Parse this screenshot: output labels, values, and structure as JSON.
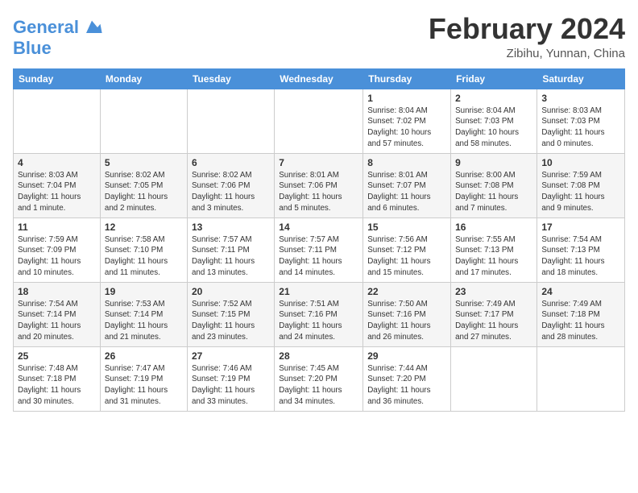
{
  "header": {
    "logo_line1": "General",
    "logo_line2": "Blue",
    "month": "February 2024",
    "location": "Zibihu, Yunnan, China"
  },
  "weekdays": [
    "Sunday",
    "Monday",
    "Tuesday",
    "Wednesday",
    "Thursday",
    "Friday",
    "Saturday"
  ],
  "weeks": [
    [
      {
        "day": "",
        "info": ""
      },
      {
        "day": "",
        "info": ""
      },
      {
        "day": "",
        "info": ""
      },
      {
        "day": "",
        "info": ""
      },
      {
        "day": "1",
        "info": "Sunrise: 8:04 AM\nSunset: 7:02 PM\nDaylight: 10 hours\nand 57 minutes."
      },
      {
        "day": "2",
        "info": "Sunrise: 8:04 AM\nSunset: 7:03 PM\nDaylight: 10 hours\nand 58 minutes."
      },
      {
        "day": "3",
        "info": "Sunrise: 8:03 AM\nSunset: 7:03 PM\nDaylight: 11 hours\nand 0 minutes."
      }
    ],
    [
      {
        "day": "4",
        "info": "Sunrise: 8:03 AM\nSunset: 7:04 PM\nDaylight: 11 hours\nand 1 minute."
      },
      {
        "day": "5",
        "info": "Sunrise: 8:02 AM\nSunset: 7:05 PM\nDaylight: 11 hours\nand 2 minutes."
      },
      {
        "day": "6",
        "info": "Sunrise: 8:02 AM\nSunset: 7:06 PM\nDaylight: 11 hours\nand 3 minutes."
      },
      {
        "day": "7",
        "info": "Sunrise: 8:01 AM\nSunset: 7:06 PM\nDaylight: 11 hours\nand 5 minutes."
      },
      {
        "day": "8",
        "info": "Sunrise: 8:01 AM\nSunset: 7:07 PM\nDaylight: 11 hours\nand 6 minutes."
      },
      {
        "day": "9",
        "info": "Sunrise: 8:00 AM\nSunset: 7:08 PM\nDaylight: 11 hours\nand 7 minutes."
      },
      {
        "day": "10",
        "info": "Sunrise: 7:59 AM\nSunset: 7:08 PM\nDaylight: 11 hours\nand 9 minutes."
      }
    ],
    [
      {
        "day": "11",
        "info": "Sunrise: 7:59 AM\nSunset: 7:09 PM\nDaylight: 11 hours\nand 10 minutes."
      },
      {
        "day": "12",
        "info": "Sunrise: 7:58 AM\nSunset: 7:10 PM\nDaylight: 11 hours\nand 11 minutes."
      },
      {
        "day": "13",
        "info": "Sunrise: 7:57 AM\nSunset: 7:11 PM\nDaylight: 11 hours\nand 13 minutes."
      },
      {
        "day": "14",
        "info": "Sunrise: 7:57 AM\nSunset: 7:11 PM\nDaylight: 11 hours\nand 14 minutes."
      },
      {
        "day": "15",
        "info": "Sunrise: 7:56 AM\nSunset: 7:12 PM\nDaylight: 11 hours\nand 15 minutes."
      },
      {
        "day": "16",
        "info": "Sunrise: 7:55 AM\nSunset: 7:13 PM\nDaylight: 11 hours\nand 17 minutes."
      },
      {
        "day": "17",
        "info": "Sunrise: 7:54 AM\nSunset: 7:13 PM\nDaylight: 11 hours\nand 18 minutes."
      }
    ],
    [
      {
        "day": "18",
        "info": "Sunrise: 7:54 AM\nSunset: 7:14 PM\nDaylight: 11 hours\nand 20 minutes."
      },
      {
        "day": "19",
        "info": "Sunrise: 7:53 AM\nSunset: 7:14 PM\nDaylight: 11 hours\nand 21 minutes."
      },
      {
        "day": "20",
        "info": "Sunrise: 7:52 AM\nSunset: 7:15 PM\nDaylight: 11 hours\nand 23 minutes."
      },
      {
        "day": "21",
        "info": "Sunrise: 7:51 AM\nSunset: 7:16 PM\nDaylight: 11 hours\nand 24 minutes."
      },
      {
        "day": "22",
        "info": "Sunrise: 7:50 AM\nSunset: 7:16 PM\nDaylight: 11 hours\nand 26 minutes."
      },
      {
        "day": "23",
        "info": "Sunrise: 7:49 AM\nSunset: 7:17 PM\nDaylight: 11 hours\nand 27 minutes."
      },
      {
        "day": "24",
        "info": "Sunrise: 7:49 AM\nSunset: 7:18 PM\nDaylight: 11 hours\nand 28 minutes."
      }
    ],
    [
      {
        "day": "25",
        "info": "Sunrise: 7:48 AM\nSunset: 7:18 PM\nDaylight: 11 hours\nand 30 minutes."
      },
      {
        "day": "26",
        "info": "Sunrise: 7:47 AM\nSunset: 7:19 PM\nDaylight: 11 hours\nand 31 minutes."
      },
      {
        "day": "27",
        "info": "Sunrise: 7:46 AM\nSunset: 7:19 PM\nDaylight: 11 hours\nand 33 minutes."
      },
      {
        "day": "28",
        "info": "Sunrise: 7:45 AM\nSunset: 7:20 PM\nDaylight: 11 hours\nand 34 minutes."
      },
      {
        "day": "29",
        "info": "Sunrise: 7:44 AM\nSunset: 7:20 PM\nDaylight: 11 hours\nand 36 minutes."
      },
      {
        "day": "",
        "info": ""
      },
      {
        "day": "",
        "info": ""
      }
    ]
  ]
}
